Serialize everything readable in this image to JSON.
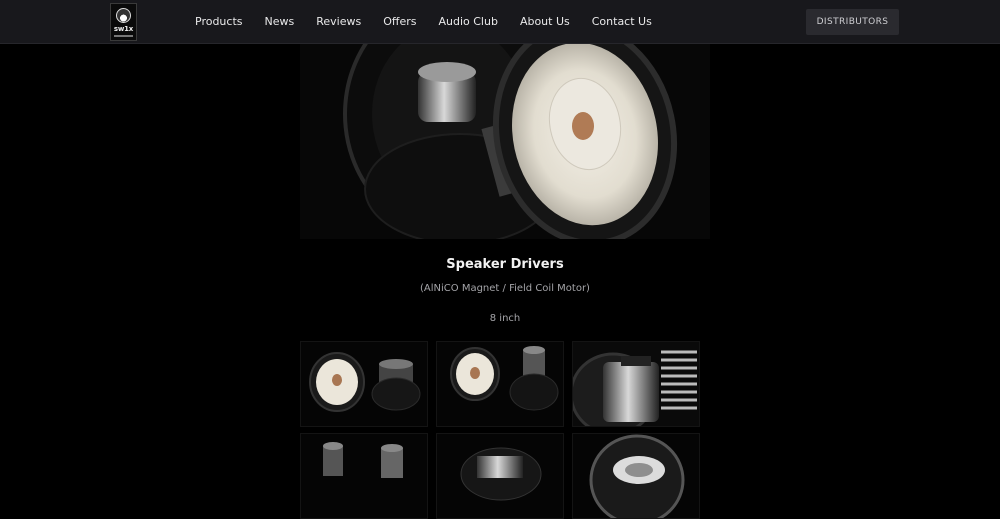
{
  "header": {
    "logo_text": "sw1x",
    "nav": [
      "Products",
      "News",
      "Reviews",
      "Offers",
      "Audio Club",
      "About Us",
      "Contact Us"
    ],
    "cta_label": "DISTRIBUTORS"
  },
  "product": {
    "title": "Speaker Drivers",
    "subtitle": "(AlNiCO Magnet / Field Coil Motor)",
    "size": "8 inch"
  }
}
